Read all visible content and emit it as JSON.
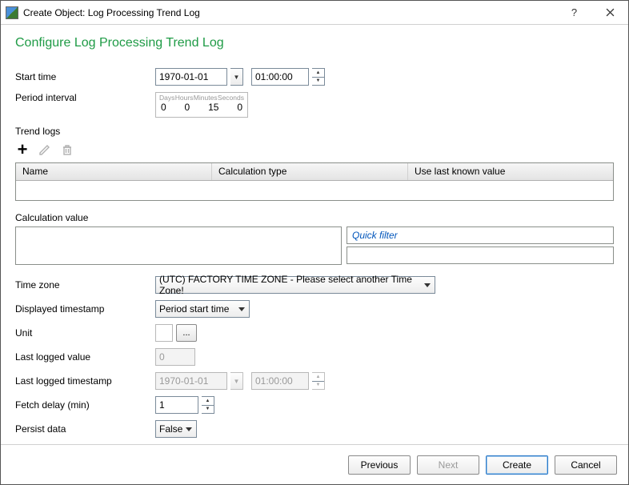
{
  "titlebar": {
    "title": "Create Object: Log Processing Trend Log"
  },
  "page_title": "Configure Log Processing Trend Log",
  "labels": {
    "start_time": "Start time",
    "period_interval": "Period interval",
    "trend_logs": "Trend logs",
    "calc_value": "Calculation value",
    "time_zone": "Time zone",
    "disp_ts": "Displayed timestamp",
    "unit": "Unit",
    "last_val": "Last logged value",
    "last_ts": "Last logged timestamp",
    "fetch_delay": "Fetch delay (min)",
    "persist": "Persist data"
  },
  "start_time": {
    "date": "1970-01-01",
    "time": "01:00:00"
  },
  "period": {
    "head": {
      "d": "Days",
      "h": "Hours",
      "m": "Minutes",
      "s": "Seconds"
    },
    "vals": {
      "d": "0",
      "h": "0",
      "m": "15",
      "s": "0"
    }
  },
  "grid_cols": {
    "name": "Name",
    "calc": "Calculation type",
    "last": "Use last known value"
  },
  "quick_filter_placeholder": "Quick filter",
  "time_zone_value": "(UTC) FACTORY TIME ZONE - Please select another Time Zone!",
  "disp_ts_value": "Period start time",
  "unit_ellipsis": "...",
  "last_val_value": "0",
  "last_ts": {
    "date": "1970-01-01",
    "time": "01:00:00"
  },
  "fetch_delay_value": "1",
  "persist_value": "False",
  "footer": {
    "prev": "Previous",
    "next": "Next",
    "create": "Create",
    "cancel": "Cancel"
  }
}
